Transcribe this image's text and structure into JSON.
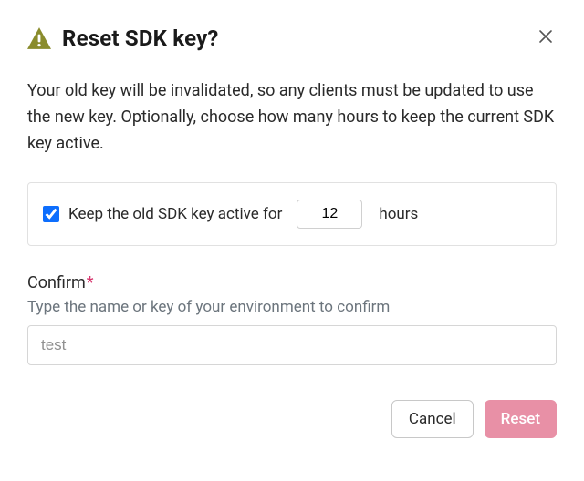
{
  "dialog": {
    "title": "Reset SDK key?",
    "description": "Your old key will be invalidated, so any clients must be updated to use the new key. Optionally, choose how many hours to keep the current SDK key active."
  },
  "option": {
    "prefix_text": "Keep the old SDK key active for",
    "hours_value": "12",
    "suffix_text": "hours",
    "checked": true
  },
  "confirm": {
    "label": "Confirm",
    "required_mark": "*",
    "hint": "Type the name or key of your environment to confirm",
    "value": "test"
  },
  "buttons": {
    "cancel": "Cancel",
    "reset": "Reset"
  },
  "icons": {
    "warning_color": "#8a8c2c"
  }
}
